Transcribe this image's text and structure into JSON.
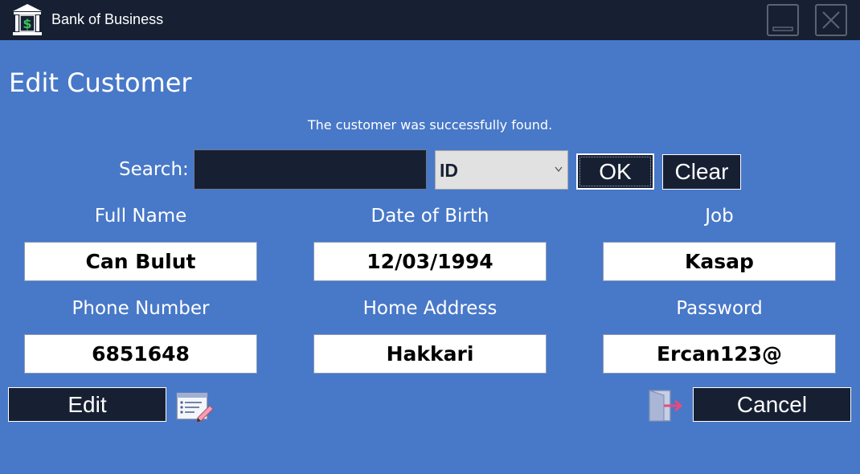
{
  "window": {
    "title": "Bank of Business",
    "icon": "bank-icon",
    "controls": [
      "minimize-icon",
      "close-icon"
    ]
  },
  "page": {
    "heading": "Edit Customer",
    "status_message": "The customer was successfully found."
  },
  "search": {
    "label": "Search:",
    "value": "",
    "type_selected": "ID",
    "ok_label": "OK",
    "clear_label": "Clear"
  },
  "fields": [
    {
      "label": "Full Name",
      "value": "Can Bulut"
    },
    {
      "label": "Date of Birth",
      "value": "12/03/1994"
    },
    {
      "label": "Job",
      "value": "Kasap"
    },
    {
      "label": "Phone Number",
      "value": "6851648"
    },
    {
      "label": "Home Address",
      "value": "Hakkari"
    },
    {
      "label": "Password",
      "value": "Ercan123@"
    }
  ],
  "actions": {
    "edit_label": "Edit",
    "edit_icon": "edit-form-icon",
    "cancel_label": "Cancel",
    "cancel_icon": "exit-icon"
  },
  "colors": {
    "background": "#4878c8",
    "titlebar": "#172033",
    "button": "#172033",
    "field": "#ffffff"
  }
}
